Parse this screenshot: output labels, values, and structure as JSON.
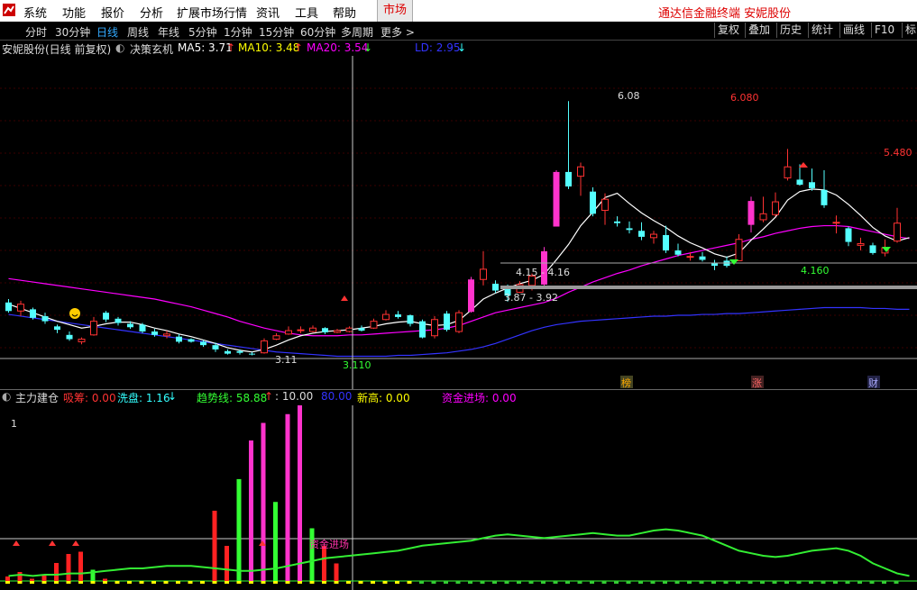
{
  "menubar": {
    "items": [
      "系统",
      "功能",
      "报价",
      "分析",
      "扩展市场行情",
      "资讯",
      "工具",
      "帮助"
    ],
    "market_tab": "市场",
    "app_title": "通达信金融终端  安妮股份"
  },
  "periodbar": {
    "items": [
      "分时",
      "30分钟",
      "日线",
      "周线",
      "年线",
      "5分钟",
      "1分钟",
      "15分钟",
      "60分钟",
      "多周期",
      "更多 >"
    ],
    "active": "日线",
    "tools": [
      "复权",
      "叠加",
      "历史",
      "统计",
      "画线",
      "F10",
      "标"
    ]
  },
  "main_info": {
    "stock": "安妮股份(日线 前复权)",
    "formula": "决策玄机",
    "ma5": "MA5: 3.71",
    "ma10": "MA10: 3.48",
    "ma20": "MA20: 3.54",
    "ld": "LD: 2.95"
  },
  "price_labels": {
    "high_top": "6.08",
    "high_axis": "6.080",
    "mid_axis": "5.480",
    "range1": "4.15 - 4.16",
    "range2": "3.87 - 3.92",
    "support": "4.160",
    "low_mark": "3.11",
    "low_axis": "3.110",
    "tags": [
      "榜",
      "涨",
      "财"
    ]
  },
  "indicator": {
    "name": "主力建仓",
    "xichou": "吸筹: 0.00",
    "xipan": "洗盘: 1.16",
    "trend": "趋势线: 58.88",
    "ten": ": 10.00",
    "eighty": "80.00",
    "newhigh": "新高: 0.00",
    "fundin": "资金进场: 0.00",
    "axis_one": "1",
    "fund_label": "资金进场"
  },
  "colors": {
    "up": "#ff3232",
    "down": "#54ffff",
    "ma5": "#ffffff",
    "ma10": "#ffff00",
    "ma20": "#ff00ff",
    "ld": "#3333ff",
    "trend": "#33ee33"
  },
  "chart_data": {
    "type": "candlestick",
    "candles": [
      {
        "o": 3.72,
        "c": 3.62,
        "h": 3.76,
        "l": 3.6
      },
      {
        "o": 3.62,
        "c": 3.7,
        "h": 3.74,
        "l": 3.56
      },
      {
        "o": 3.64,
        "c": 3.54,
        "h": 3.66,
        "l": 3.52
      },
      {
        "o": 3.56,
        "c": 3.5,
        "h": 3.6,
        "l": 3.47
      },
      {
        "o": 3.44,
        "c": 3.4,
        "h": 3.46,
        "l": 3.36
      },
      {
        "o": 3.34,
        "c": 3.29,
        "h": 3.38,
        "l": 3.27
      },
      {
        "o": 3.26,
        "c": 3.29,
        "h": 3.31,
        "l": 3.23
      },
      {
        "o": 3.34,
        "c": 3.5,
        "h": 3.55,
        "l": 3.33
      },
      {
        "o": 3.6,
        "c": 3.52,
        "h": 3.62,
        "l": 3.49
      },
      {
        "o": 3.53,
        "c": 3.48,
        "h": 3.55,
        "l": 3.45
      },
      {
        "o": 3.47,
        "c": 3.43,
        "h": 3.5,
        "l": 3.41
      },
      {
        "o": 3.46,
        "c": 3.38,
        "h": 3.48,
        "l": 3.36
      },
      {
        "o": 3.38,
        "c": 3.34,
        "h": 3.41,
        "l": 3.32
      },
      {
        "o": 3.33,
        "c": 3.35,
        "h": 3.39,
        "l": 3.3
      },
      {
        "o": 3.32,
        "c": 3.26,
        "h": 3.35,
        "l": 3.24
      },
      {
        "o": 3.29,
        "c": 3.26,
        "h": 3.3,
        "l": 3.25
      },
      {
        "o": 3.26,
        "c": 3.22,
        "h": 3.28,
        "l": 3.2
      },
      {
        "o": 3.22,
        "c": 3.17,
        "h": 3.25,
        "l": 3.14
      },
      {
        "o": 3.15,
        "c": 3.12,
        "h": 3.17,
        "l": 3.11
      },
      {
        "o": 3.15,
        "c": 3.13,
        "h": 3.17,
        "l": 3.11
      },
      {
        "o": 3.12,
        "c": 3.11,
        "h": 3.14,
        "l": 3.1
      },
      {
        "o": 3.13,
        "c": 3.27,
        "h": 3.3,
        "l": 3.12
      },
      {
        "o": 3.29,
        "c": 3.33,
        "h": 3.36,
        "l": 3.28
      },
      {
        "o": 3.35,
        "c": 3.39,
        "h": 3.44,
        "l": 3.34
      },
      {
        "o": 3.4,
        "c": 3.4,
        "h": 3.44,
        "l": 3.36
      },
      {
        "o": 3.38,
        "c": 3.42,
        "h": 3.45,
        "l": 3.37
      },
      {
        "o": 3.42,
        "c": 3.37,
        "h": 3.43,
        "l": 3.35
      },
      {
        "o": 3.37,
        "c": 3.39,
        "h": 3.41,
        "l": 3.36
      },
      {
        "o": 3.38,
        "c": 3.42,
        "h": 3.44,
        "l": 3.37
      },
      {
        "o": 3.42,
        "c": 3.39,
        "h": 3.45,
        "l": 3.38
      },
      {
        "o": 3.42,
        "c": 3.5,
        "h": 3.53,
        "l": 3.41
      },
      {
        "o": 3.52,
        "c": 3.58,
        "h": 3.63,
        "l": 3.51
      },
      {
        "o": 3.58,
        "c": 3.55,
        "h": 3.62,
        "l": 3.53
      },
      {
        "o": 3.57,
        "c": 3.47,
        "h": 3.58,
        "l": 3.44
      },
      {
        "o": 3.5,
        "c": 3.31,
        "h": 3.52,
        "l": 3.3
      },
      {
        "o": 3.33,
        "c": 3.52,
        "h": 3.56,
        "l": 3.3
      },
      {
        "o": 3.59,
        "c": 3.4,
        "h": 3.62,
        "l": 3.38
      },
      {
        "o": 3.38,
        "c": 3.6,
        "h": 3.63,
        "l": 3.36
      },
      {
        "o": 3.61,
        "c": 3.99,
        "h": 4.02,
        "l": 3.6
      },
      {
        "o": 3.99,
        "c": 4.11,
        "h": 4.32,
        "l": 3.92
      },
      {
        "o": 3.94,
        "c": 3.86,
        "h": 3.98,
        "l": 3.83
      },
      {
        "o": 3.89,
        "c": 3.8,
        "h": 3.93,
        "l": 3.73
      },
      {
        "o": 3.84,
        "c": 3.93,
        "h": 3.97,
        "l": 3.83
      },
      {
        "o": 3.92,
        "c": 4.03,
        "h": 4.06,
        "l": 3.86
      },
      {
        "o": 3.93,
        "c": 4.32,
        "h": 4.37,
        "l": 3.9
      },
      {
        "o": 4.61,
        "c": 5.25,
        "h": 5.27,
        "l": 4.61
      },
      {
        "o": 5.25,
        "c": 5.08,
        "h": 6.08,
        "l": 5.05
      },
      {
        "o": 5.2,
        "c": 5.31,
        "h": 5.36,
        "l": 4.97
      },
      {
        "o": 5.02,
        "c": 4.76,
        "h": 5.07,
        "l": 4.73
      },
      {
        "o": 4.8,
        "c": 4.93,
        "h": 5.0,
        "l": 4.63
      },
      {
        "o": 4.67,
        "c": 4.65,
        "h": 4.73,
        "l": 4.61
      },
      {
        "o": 4.59,
        "c": 4.57,
        "h": 4.67,
        "l": 4.53
      },
      {
        "o": 4.56,
        "c": 4.49,
        "h": 4.66,
        "l": 4.45
      },
      {
        "o": 4.48,
        "c": 4.52,
        "h": 4.56,
        "l": 4.41
      },
      {
        "o": 4.51,
        "c": 4.33,
        "h": 4.62,
        "l": 4.3
      },
      {
        "o": 4.33,
        "c": 4.28,
        "h": 4.41,
        "l": 4.26
      },
      {
        "o": 4.26,
        "c": 4.26,
        "h": 4.31,
        "l": 4.21
      },
      {
        "o": 4.26,
        "c": 4.22,
        "h": 4.31,
        "l": 4.2
      },
      {
        "o": 4.18,
        "c": 4.15,
        "h": 4.22,
        "l": 4.1
      },
      {
        "o": 4.21,
        "c": 4.15,
        "h": 4.26,
        "l": 4.13
      },
      {
        "o": 4.21,
        "c": 4.46,
        "h": 4.52,
        "l": 4.21
      },
      {
        "o": 4.63,
        "c": 4.91,
        "h": 4.96,
        "l": 4.54
      },
      {
        "o": 4.69,
        "c": 4.76,
        "h": 4.96,
        "l": 4.66
      },
      {
        "o": 4.75,
        "c": 4.9,
        "h": 5.01,
        "l": 4.73
      },
      {
        "o": 5.18,
        "c": 5.31,
        "h": 5.52,
        "l": 5.15
      },
      {
        "o": 5.16,
        "c": 5.1,
        "h": 5.34,
        "l": 5.09
      },
      {
        "o": 5.13,
        "c": 5.06,
        "h": 5.29,
        "l": 5.03
      },
      {
        "o": 5.04,
        "c": 4.86,
        "h": 5.27,
        "l": 4.83
      },
      {
        "o": 4.65,
        "c": 4.66,
        "h": 4.74,
        "l": 4.53
      },
      {
        "o": 4.59,
        "c": 4.43,
        "h": 4.61,
        "l": 4.38
      },
      {
        "o": 4.39,
        "c": 4.41,
        "h": 4.48,
        "l": 4.33
      },
      {
        "o": 4.39,
        "c": 4.3,
        "h": 4.42,
        "l": 4.28
      },
      {
        "o": 4.3,
        "c": 4.36,
        "h": 4.46,
        "l": 4.26
      },
      {
        "o": 4.44,
        "c": 4.65,
        "h": 4.83,
        "l": 4.42
      }
    ],
    "ma5": [
      3.7,
      3.65,
      3.6,
      3.55,
      3.5,
      3.46,
      3.42,
      3.44,
      3.47,
      3.49,
      3.49,
      3.46,
      3.42,
      3.39,
      3.35,
      3.32,
      3.28,
      3.24,
      3.19,
      3.16,
      3.14,
      3.17,
      3.22,
      3.28,
      3.33,
      3.36,
      3.38,
      3.39,
      3.4,
      3.42,
      3.44,
      3.47,
      3.49,
      3.5,
      3.47,
      3.45,
      3.46,
      3.51,
      3.63,
      3.76,
      3.83,
      3.89,
      3.94,
      3.98,
      4.05,
      4.22,
      4.4,
      4.62,
      4.78,
      4.95,
      5.0,
      4.88,
      4.77,
      4.68,
      4.6,
      4.5,
      4.42,
      4.36,
      4.29,
      4.25,
      4.3,
      4.45,
      4.58,
      4.72,
      4.92,
      5.02,
      5.05,
      5.04,
      4.98,
      4.87,
      4.74,
      4.6,
      4.5,
      4.44,
      4.48
    ],
    "ma20": [
      4.0,
      3.98,
      3.96,
      3.94,
      3.92,
      3.9,
      3.88,
      3.86,
      3.84,
      3.82,
      3.8,
      3.78,
      3.76,
      3.73,
      3.7,
      3.67,
      3.63,
      3.59,
      3.55,
      3.5,
      3.46,
      3.42,
      3.39,
      3.36,
      3.34,
      3.33,
      3.33,
      3.33,
      3.34,
      3.34,
      3.35,
      3.36,
      3.37,
      3.38,
      3.39,
      3.4,
      3.42,
      3.45,
      3.5,
      3.55,
      3.6,
      3.63,
      3.66,
      3.69,
      3.72,
      3.77,
      3.84,
      3.9,
      3.96,
      4.01,
      4.06,
      4.1,
      4.15,
      4.19,
      4.23,
      4.27,
      4.3,
      4.33,
      4.36,
      4.39,
      4.42,
      4.46,
      4.49,
      4.53,
      4.56,
      4.59,
      4.61,
      4.62,
      4.62,
      4.61,
      4.58,
      4.55,
      4.52,
      4.49,
      4.47
    ],
    "ld": [
      3.58,
      3.56,
      3.54,
      3.52,
      3.5,
      3.48,
      3.46,
      3.44,
      3.42,
      3.4,
      3.38,
      3.36,
      3.34,
      3.32,
      3.3,
      3.28,
      3.26,
      3.24,
      3.22,
      3.2,
      3.18,
      3.16,
      3.14,
      3.13,
      3.12,
      3.11,
      3.1,
      3.09,
      3.09,
      3.09,
      3.09,
      3.09,
      3.1,
      3.1,
      3.11,
      3.12,
      3.13,
      3.15,
      3.17,
      3.2,
      3.24,
      3.29,
      3.34,
      3.39,
      3.43,
      3.46,
      3.48,
      3.5,
      3.51,
      3.52,
      3.53,
      3.54,
      3.55,
      3.56,
      3.56,
      3.57,
      3.57,
      3.58,
      3.58,
      3.59,
      3.59,
      3.6,
      3.61,
      3.62,
      3.63,
      3.64,
      3.65,
      3.66,
      3.66,
      3.66,
      3.66,
      3.65,
      3.65,
      3.64,
      3.64
    ],
    "indicator_bars": [
      2,
      4,
      1,
      3,
      8,
      12,
      13,
      5,
      1,
      0,
      0,
      0,
      0,
      0,
      0,
      0,
      0,
      0,
      0,
      0,
      0,
      0,
      0,
      0,
      0,
      0,
      0,
      0,
      0,
      0,
      0,
      0,
      0,
      0,
      0,
      0,
      0,
      0,
      0,
      0,
      0,
      0,
      0,
      0,
      0,
      0,
      0,
      0,
      0,
      0,
      0,
      0,
      0,
      0,
      0,
      0,
      0,
      0,
      0,
      0,
      0,
      0,
      0,
      0,
      0,
      0,
      0,
      0,
      0,
      0,
      0,
      0,
      0,
      0,
      0
    ],
    "indicator_big_bars": [
      0,
      0,
      0,
      0,
      0,
      0,
      0,
      0,
      0,
      0,
      0,
      0,
      0,
      0,
      0,
      0,
      0,
      40,
      20,
      58,
      80,
      90,
      45,
      95,
      100,
      30,
      20,
      10,
      0,
      0,
      0,
      0,
      0,
      0,
      0,
      0,
      0,
      0,
      0,
      0,
      0,
      0,
      0,
      0,
      0,
      0,
      0,
      0,
      0,
      0,
      0,
      0,
      0,
      0,
      0,
      0,
      0,
      0,
      0,
      0,
      0,
      0,
      0,
      0,
      0,
      0,
      0,
      0,
      0,
      0,
      0,
      0,
      0,
      0,
      0
    ],
    "trend_line": [
      4,
      5,
      4,
      5,
      5,
      6,
      6,
      7,
      8,
      9,
      10,
      10,
      11,
      12,
      12,
      12,
      11,
      10,
      9,
      8,
      8,
      9,
      10,
      12,
      14,
      16,
      18,
      19,
      20,
      21,
      22,
      23,
      24,
      26,
      28,
      29,
      30,
      31,
      32,
      34,
      36,
      37,
      36,
      35,
      34,
      35,
      36,
      37,
      38,
      37,
      36,
      36,
      38,
      40,
      41,
      40,
      38,
      36,
      32,
      28,
      24,
      22,
      20,
      19,
      20,
      22,
      24,
      25,
      26,
      24,
      20,
      14,
      10,
      6,
      4
    ],
    "price_range": [
      3.0,
      6.4
    ]
  }
}
